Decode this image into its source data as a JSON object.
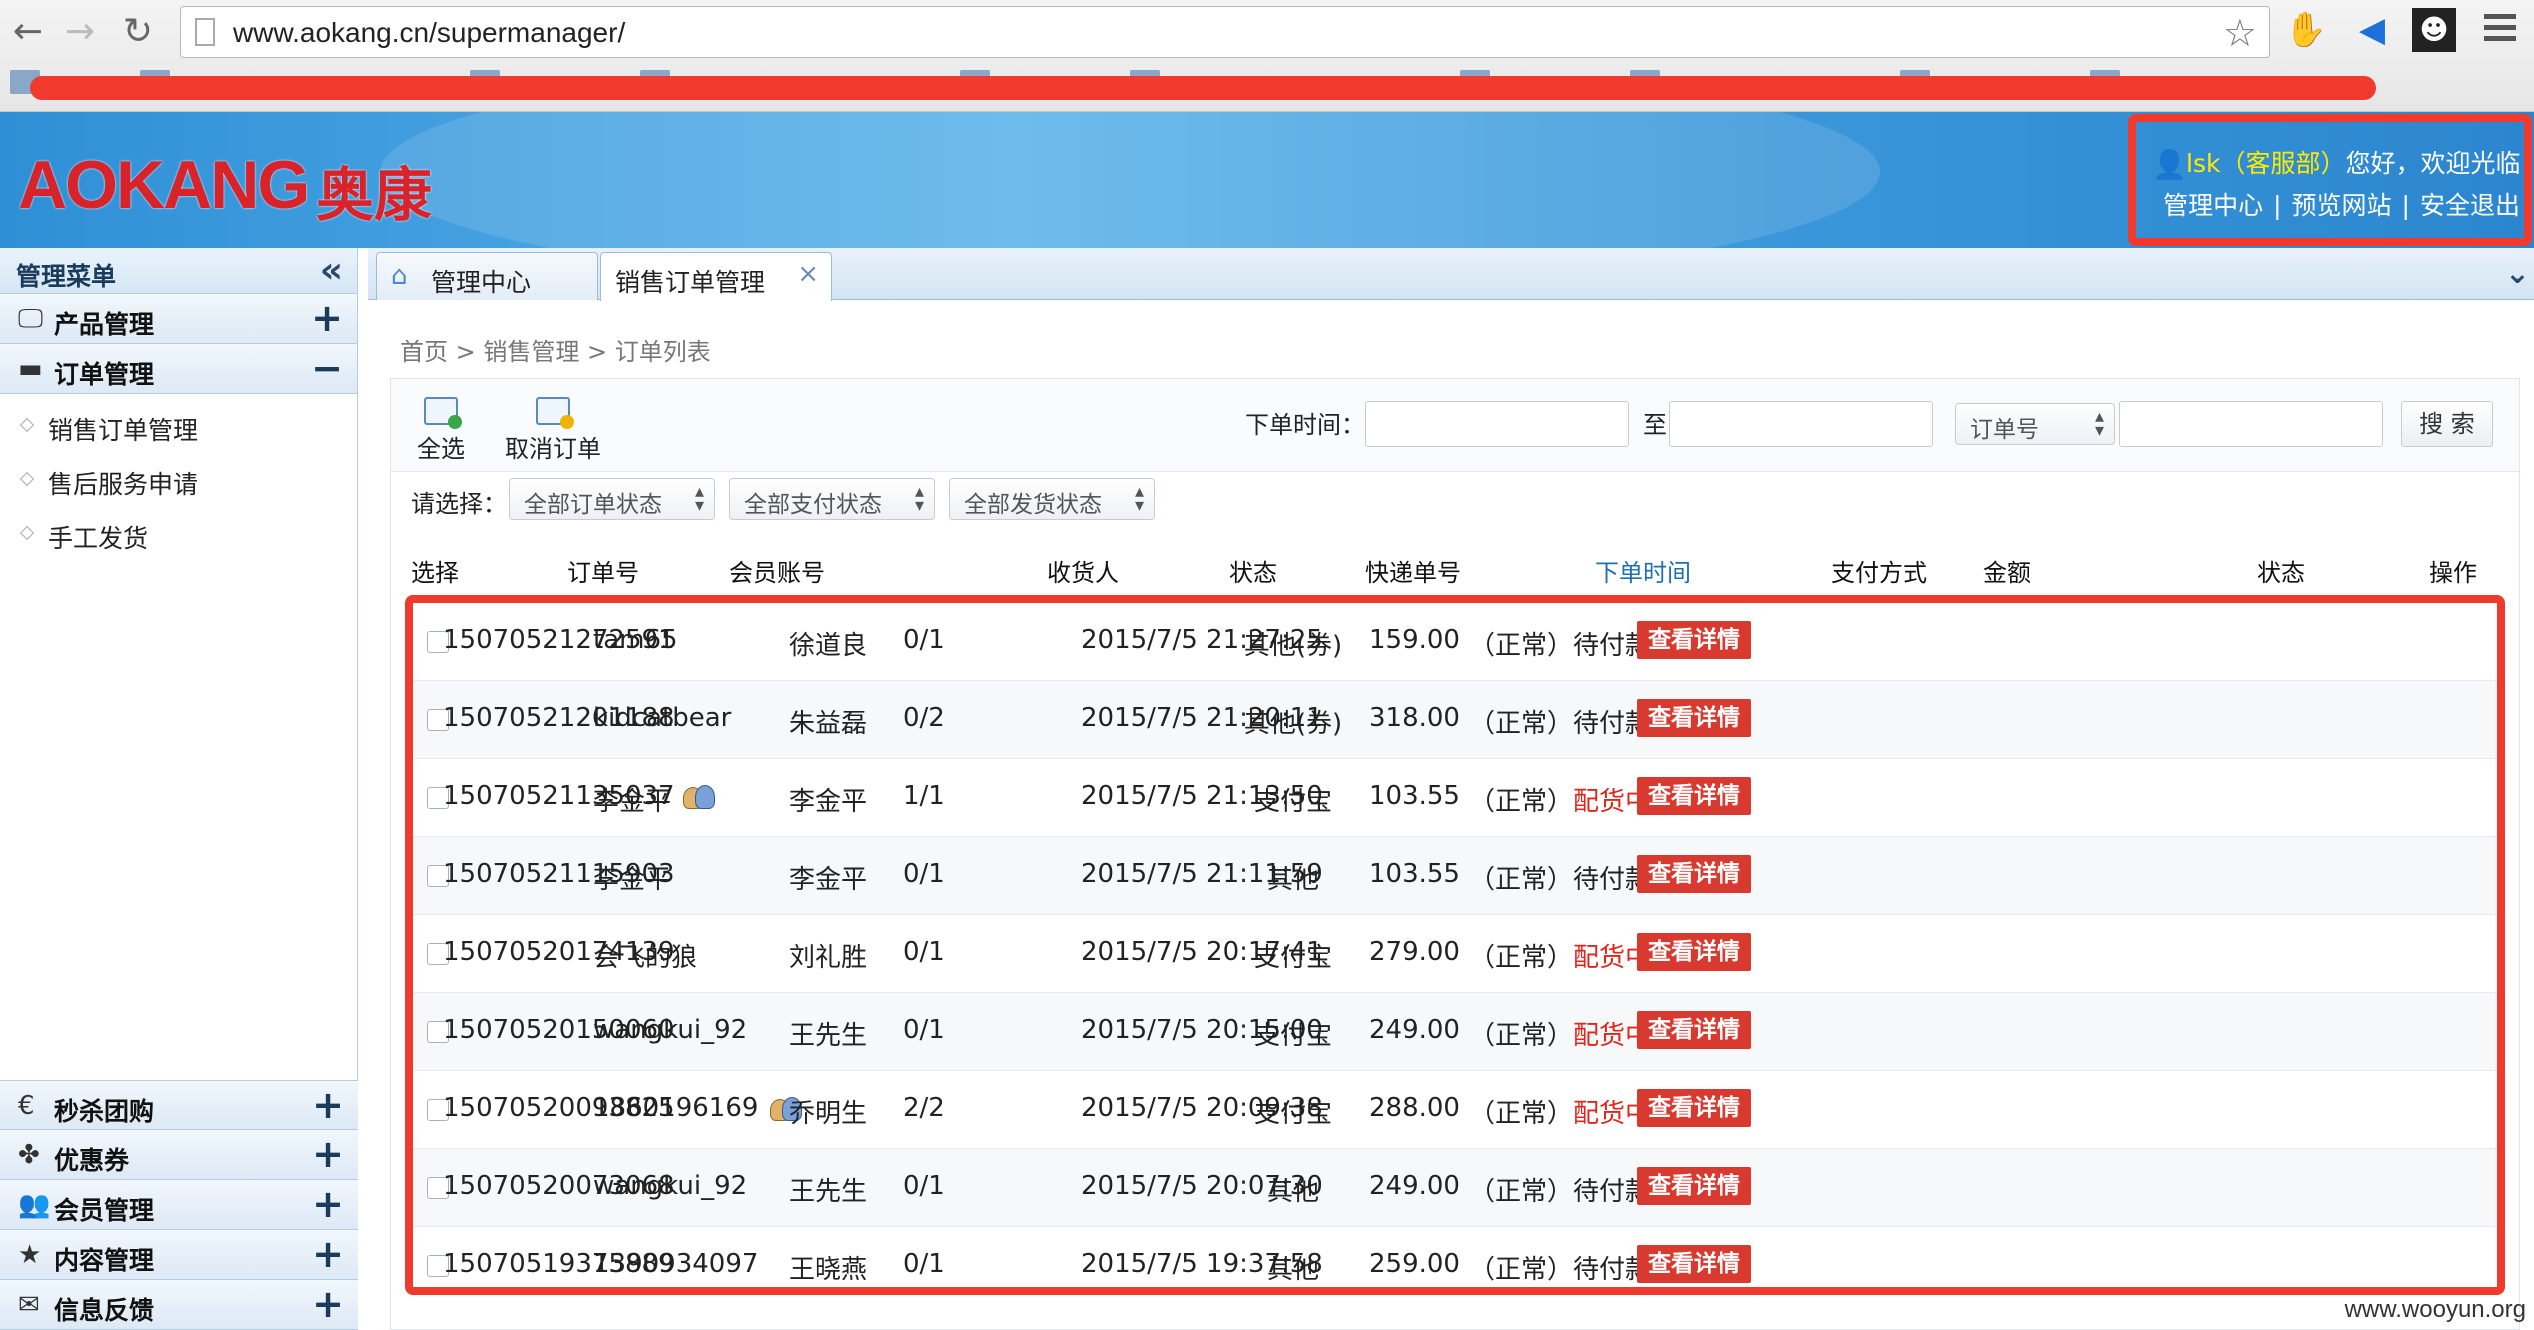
{
  "browser": {
    "url": "www.aokang.cn/supermanager/"
  },
  "header": {
    "logo_text": "AOKANG",
    "logo_cn": "奥康",
    "user_name": "lsk（客服部）",
    "user_greeting": "您好，欢迎光临",
    "links": [
      "管理中心",
      "预览网站",
      "安全退出"
    ],
    "link_separator": "|"
  },
  "sidebar": {
    "title": "管理菜单",
    "collapse_icon": "«",
    "sections_top": [
      {
        "label": "产品管理",
        "icon": "monitor-icon",
        "toggle": "+"
      },
      {
        "label": "订单管理",
        "icon": "chat-icon",
        "toggle": "−"
      }
    ],
    "order_items": [
      "销售订单管理",
      "售后服务申请",
      "手工发货"
    ],
    "sections_bottom": [
      {
        "label": "秒杀团购",
        "icon": "coin-icon",
        "toggle": "+"
      },
      {
        "label": "优惠券",
        "icon": "leaf-icon",
        "toggle": "+"
      },
      {
        "label": "会员管理",
        "icon": "users-icon",
        "toggle": "+"
      },
      {
        "label": "内容管理",
        "icon": "star-icon",
        "toggle": "+"
      },
      {
        "label": "信息反馈",
        "icon": "mail-icon",
        "toggle": "+"
      }
    ]
  },
  "tabs": [
    {
      "label": "管理中心",
      "icon": "home-icon"
    },
    {
      "label": "销售订单管理",
      "close": "×"
    }
  ],
  "breadcrumb": "首页 > 销售管理 > 订单列表",
  "toolbar": {
    "select_all": "全选",
    "cancel_order": "取消订单",
    "order_time_label": "下单时间：",
    "to_label": "至",
    "order_no_select": "订单号",
    "search_button": "搜 索"
  },
  "filter": {
    "label": "请选择：",
    "order_status": "全部订单状态",
    "pay_status": "全部支付状态",
    "ship_status": "全部发货状态"
  },
  "table": {
    "headers": [
      "选择",
      "订单号",
      "会员账号",
      "收货人",
      "状态",
      "快递单号",
      "下单时间",
      "支付方式",
      "金额",
      "状态",
      "操作"
    ],
    "status_prefix": "（正常）",
    "view_button": "查看详情",
    "rows": [
      {
        "order": "15070521272591",
        "member": "tam65",
        "vip": false,
        "receiver": "徐道良",
        "state": "0/1",
        "time": "2015/7/5 21:27:25",
        "pay": "其他(券)",
        "amount": "159.00",
        "status": "待付款",
        "status_red": false
      },
      {
        "order": "15070521201188",
        "member": "kidcatbear",
        "vip": false,
        "receiver": "朱益磊",
        "state": "0/2",
        "time": "2015/7/5 21:20:11",
        "pay": "其他(券)",
        "amount": "318.00",
        "status": "待付款",
        "status_red": false
      },
      {
        "order": "15070521135037",
        "member": "李金平",
        "vip": true,
        "receiver": "李金平",
        "state": "1/1",
        "time": "2015/7/5 21:13:50",
        "pay": "支付宝",
        "amount": "103.55",
        "status": "配货中",
        "status_red": true
      },
      {
        "order": "15070521115903",
        "member": "李金平",
        "vip": false,
        "receiver": "李金平",
        "state": "0/1",
        "time": "2015/7/5 21:11:59",
        "pay": "其他",
        "amount": "103.55",
        "status": "待付款",
        "status_red": false
      },
      {
        "order": "15070520174139",
        "member": "会飞的狼",
        "vip": false,
        "receiver": "刘礼胜",
        "state": "0/1",
        "time": "2015/7/5 20:17:41",
        "pay": "支付宝",
        "amount": "279.00",
        "status": "配货中",
        "status_red": true
      },
      {
        "order": "15070520150060",
        "member": "wangkui_92",
        "vip": false,
        "receiver": "王先生",
        "state": "0/1",
        "time": "2015/7/5 20:15:00",
        "pay": "支付宝",
        "amount": "249.00",
        "status": "配货中",
        "status_red": true
      },
      {
        "order": "15070520093825",
        "member": "1860196169",
        "vip": true,
        "receiver": "乔明生",
        "state": "2/2",
        "time": "2015/7/5 20:09:38",
        "pay": "支付宝",
        "amount": "288.00",
        "status": "配货中",
        "status_red": true
      },
      {
        "order": "15070520073068",
        "member": "wangkui_92",
        "vip": false,
        "receiver": "王先生",
        "state": "0/1",
        "time": "2015/7/5 20:07:30",
        "pay": "其他",
        "amount": "249.00",
        "status": "待付款",
        "status_red": false
      },
      {
        "order": "15070519375889",
        "member": "1390934097",
        "vip": false,
        "receiver": "王晓燕",
        "state": "0/1",
        "time": "2015/7/5 19:37:58",
        "pay": "其他",
        "amount": "259.00",
        "status": "待付款",
        "status_red": false
      }
    ]
  },
  "watermark": "www.wooyun.org",
  "colors": {
    "accent_red": "#e0251b",
    "header_blue": "#3a97da",
    "highlight_red": "#f03a2e"
  }
}
